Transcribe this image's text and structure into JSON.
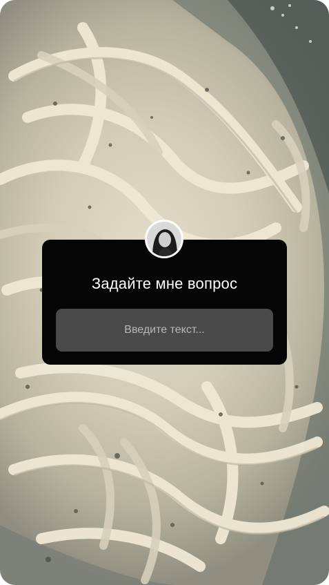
{
  "story": {
    "background_image": "pasta-photo",
    "question_sticker": {
      "avatar_icon": "profile-photo-icon",
      "title": "Задайте мне вопрос",
      "input_placeholder": "Введите текст..."
    }
  },
  "colors": {
    "card_background": "#050505",
    "input_background": "#4a4a4a",
    "title_text": "#ffffff",
    "placeholder_text": "#b8b8b8"
  }
}
